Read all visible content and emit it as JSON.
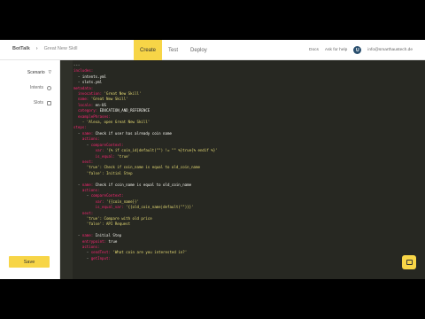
{
  "header": {
    "app_name": "BotTalk",
    "skill_name": "Great New Skill",
    "tabs": [
      "Create",
      "Test",
      "Deploy"
    ],
    "links": [
      "Docs",
      "Ask for help"
    ],
    "avatar_letter": "U",
    "user_email": "info@smarthaustech.de"
  },
  "sidebar": {
    "items": [
      "Scenario",
      "Intents",
      "Slots"
    ],
    "save_label": "Save"
  },
  "editor": {
    "lines": [
      "---",
      "includes:",
      "  - intents.yml",
      "  - slots.yml",
      "metadata:",
      "  invocation: 'Great New Skill'",
      "  name: 'Great New Skill'",
      "  locale: en-US",
      "  category: EDUCATION_AND_REFERENCE",
      "  examplePhrases:",
      "    - 'Alexa, open Great New Skill'",
      "steps:",
      "  - name: Check if user has already coin name",
      "    actions:",
      "      - compareContext:",
      "          var: '{% if coin_id|default(\"\") != \"\" %}true{% endif %}'",
      "          is_equal: 'true'",
      "    next:",
      "      'true': Check if coin_name is equal to old_coin_name",
      "      'false': Initial Step",
      "",
      "  - name: Check if coin_name is equal to old_coin_name",
      "    actions:",
      "      - compareContext:",
      "          var: '{{coin_name}}'",
      "          is_equal_var: '{{old_coin_name|default(\"\")}}'",
      "    next:",
      "      'true': Compare with old price",
      "      'false': API Request",
      "",
      "  - name: Initial Step",
      "    entrypoint: true",
      "    actions:",
      "      - sendText: 'What coin are you interested in?'",
      "      - getInput:"
    ]
  }
}
